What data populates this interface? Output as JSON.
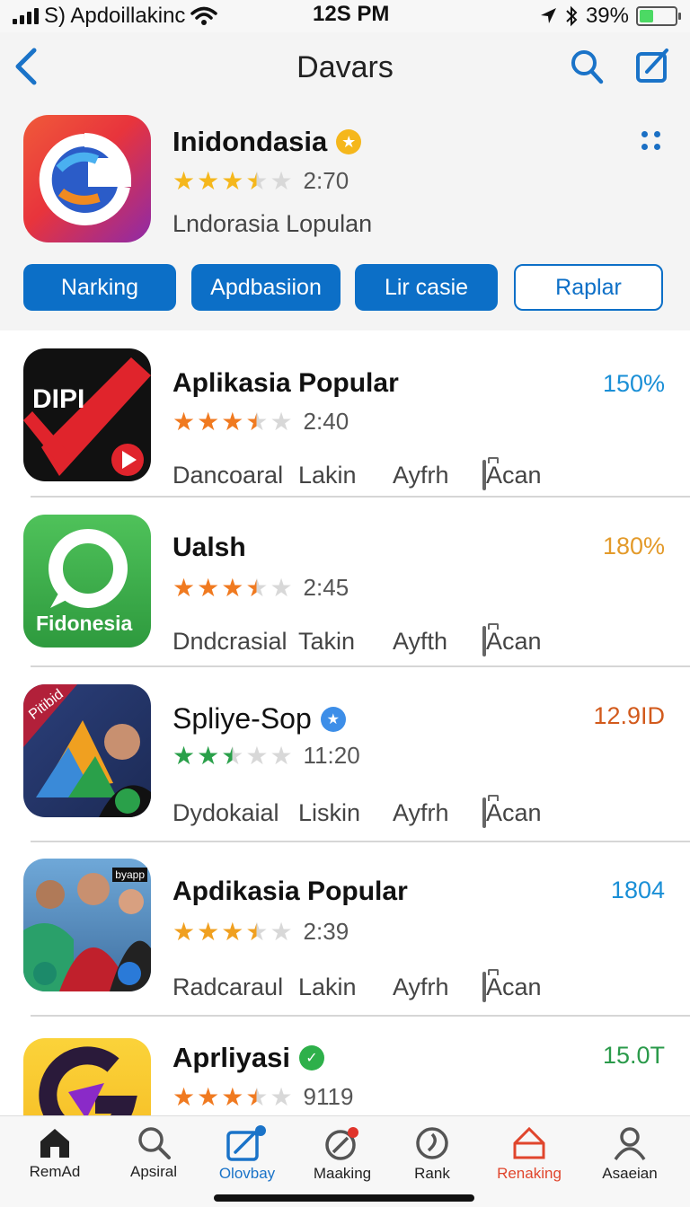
{
  "status_bar": {
    "carrier": "S) Apdoillakinc",
    "time": "12S PM",
    "battery": "39%",
    "battery_level": 0.39
  },
  "header": {
    "title": "Davars",
    "back_icon": "chevron-left-icon",
    "search_icon": "search-icon",
    "compose_icon": "compose-icon"
  },
  "featured": {
    "name": "Inidondasia",
    "badge_icon": "star-badge-icon",
    "rating": 3.5,
    "rating_text": "2:70",
    "subtitle": "Lndorasia Lopulan",
    "more_icon": "grid-dots-icon",
    "pills": [
      "Narking",
      "Apdbasiion",
      "Lir casie",
      "Raplar"
    ]
  },
  "apps": [
    {
      "name": "Aplikasia Popular",
      "rating": 3.5,
      "rating_text": "2:40",
      "price": "150%",
      "price_color": "#1a8fd6",
      "star_color": "#f07a20",
      "meta": [
        "Dancoaral",
        "Lakin",
        "Ayfrh",
        "Acan"
      ],
      "icon": "dipi-app-icon",
      "icon_text": "DIPI"
    },
    {
      "name": "Ualsh",
      "rating": 3.5,
      "rating_text": "2:45",
      "price": "180%",
      "price_color": "#e39a2a",
      "star_color": "#f07a20",
      "meta": [
        "Dndcrasial",
        "Takin",
        "Ayfth",
        "Acan"
      ],
      "icon": "chat-bubble-app-icon",
      "icon_text": "Fidonesia"
    },
    {
      "name": "Spliye-Sop",
      "badge_color": "#3d8ee8",
      "rating": 2.5,
      "rating_text": "11:20",
      "price": "12.9ID",
      "price_color": "#d25a1c",
      "star_color": "#2aa04a",
      "meta": [
        "Dydokaial",
        "Liskin",
        "Ayfrh",
        "Acan"
      ],
      "icon": "photo-app-icon",
      "icon_text": "Pitibid"
    },
    {
      "name": "Apdikasia Popular",
      "rating": 3.5,
      "rating_text": "2:39",
      "price": "1804",
      "price_color": "#1a8fd6",
      "star_color": "#f0a020",
      "meta": [
        "Radcaraul",
        "Lakin",
        "Ayfrh",
        "Acan"
      ],
      "icon": "group-photo-app-icon",
      "icon_text": "byapp"
    },
    {
      "name": "Aprliyasi",
      "badge_color": "#2eb04a",
      "rating": 3.5,
      "rating_text": "9119",
      "price": "15.0T",
      "price_color": "#2a9a4a",
      "star_color": "#f07a20",
      "meta": [],
      "icon": "g-letter-app-icon",
      "icon_text": "G"
    }
  ],
  "tabs": [
    {
      "label": "RemAd",
      "icon": "home-icon",
      "active": false
    },
    {
      "label": "Apsiral",
      "icon": "search-icon",
      "active": false
    },
    {
      "label": "Olovbay",
      "icon": "edit-icon",
      "active": true
    },
    {
      "label": "Maaking",
      "icon": "compass-icon",
      "active": false
    },
    {
      "label": "Rank",
      "icon": "rank-icon",
      "active": false
    },
    {
      "label": "Renaking",
      "icon": "bag-icon",
      "active": false,
      "highlight": true
    },
    {
      "label": "Asaeian",
      "icon": "person-icon",
      "active": false
    }
  ]
}
